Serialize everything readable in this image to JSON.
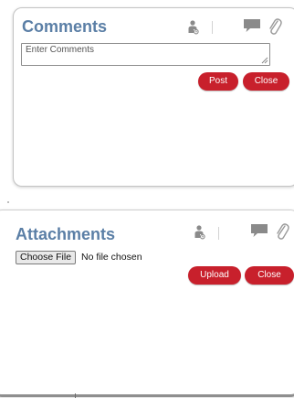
{
  "comments": {
    "title": "Comments",
    "input_placeholder": "Enter Comments",
    "input_value": "",
    "post_label": "Post",
    "close_label": "Close",
    "icons": [
      "person-icon",
      "speech-bubble-icon",
      "paperclip-icon"
    ]
  },
  "attachments": {
    "title": "Attachments",
    "choose_file_label": "Choose File",
    "file_status": "No file chosen",
    "upload_label": "Upload",
    "close_label": "Close",
    "icons": [
      "person-icon",
      "speech-bubble-icon",
      "paperclip-icon"
    ]
  },
  "colors": {
    "title": "#5b7fa6",
    "button_bg": "#c8202c",
    "button_text": "#ffffff",
    "icon_gray": "#8a8a8a"
  }
}
